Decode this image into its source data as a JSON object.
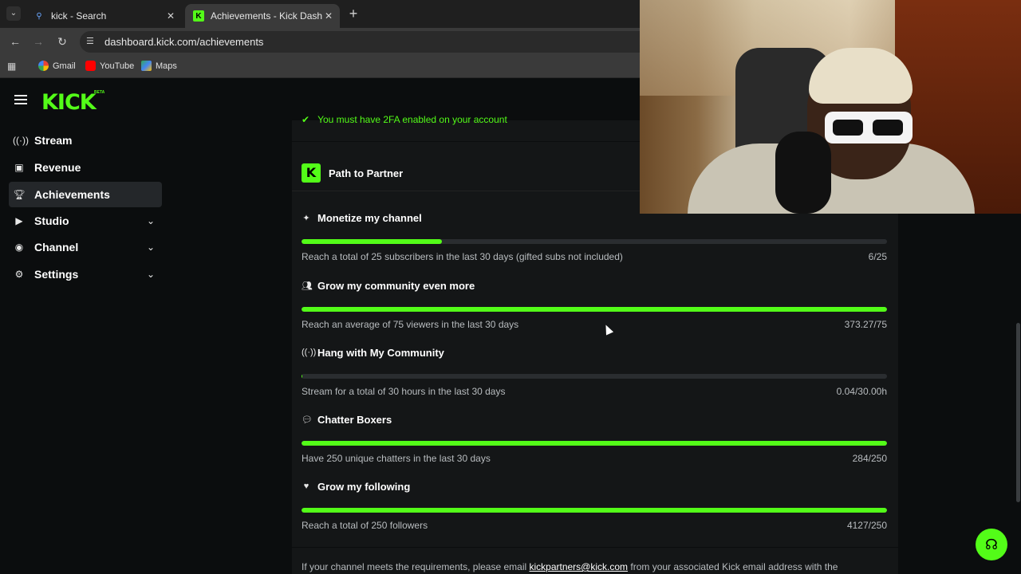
{
  "browser": {
    "tabs": [
      {
        "title": "kick - Search",
        "active": false
      },
      {
        "title": "Achievements - Kick Dashboard",
        "active": true
      }
    ],
    "url": "dashboard.kick.com/achievements",
    "bookmarks": [
      "Gmail",
      "YouTube",
      "Maps"
    ]
  },
  "app": {
    "logo": "KICK",
    "logo_beta": "BETA",
    "accent_color": "#53fc18"
  },
  "sidebar": {
    "items": [
      {
        "label": "Stream",
        "icon": "broadcast-icon"
      },
      {
        "label": "Revenue",
        "icon": "chart-icon"
      },
      {
        "label": "Achievements",
        "icon": "trophy-icon",
        "active": true
      },
      {
        "label": "Studio",
        "icon": "studio-icon",
        "expandable": true
      },
      {
        "label": "Channel",
        "icon": "user-icon",
        "expandable": true
      },
      {
        "label": "Settings",
        "icon": "gear-icon",
        "expandable": true
      }
    ]
  },
  "main": {
    "previous_requirement": "You must have 2FA enabled on your account",
    "section_title": "Path to Partner",
    "achievements": [
      {
        "title": "Monetize my channel",
        "icon": "sparkle-icon",
        "description": "Reach a total of 25 subscribers in the last 30 days (gifted subs not included)",
        "value": "6/25",
        "progress": 0.24
      },
      {
        "title": "Grow my community even more",
        "icon": "community-icon",
        "description": "Reach an average of 75 viewers in the last 30 days",
        "value": "373.27/75",
        "progress": 1.0
      },
      {
        "title": "Hang with My Community",
        "icon": "broadcast-icon",
        "description": "Stream for a total of 30 hours in the last 30 days",
        "value": "0.04/30.00h",
        "progress": 0.0013
      },
      {
        "title": "Chatter Boxers",
        "icon": "chat-icon",
        "description": "Have 250 unique chatters in the last 30 days",
        "value": "284/250",
        "progress": 1.0
      },
      {
        "title": "Grow my following",
        "icon": "heart-icon",
        "description": "Reach a total of 250 followers",
        "value": "4127/250",
        "progress": 1.0
      }
    ],
    "footer_prefix": "If your channel meets the requirements, please email ",
    "footer_email": "kickpartners@kick.com",
    "footer_suffix": " from your associated Kick email address with the"
  }
}
